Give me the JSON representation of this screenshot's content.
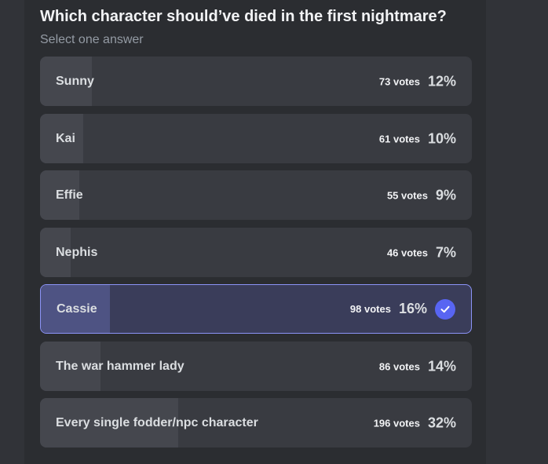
{
  "poll": {
    "question": "Which character should’ve died in the first nightmare?",
    "subtitle": "Select one answer",
    "accent_color": "#5865f2",
    "selected_border_color": "#8c94f8",
    "options": [
      {
        "label": "Sunny",
        "votes": "73 votes",
        "percent": "12%",
        "fraction": 0.12,
        "selected": false
      },
      {
        "label": "Kai",
        "votes": "61 votes",
        "percent": "10%",
        "fraction": 0.1,
        "selected": false
      },
      {
        "label": "Effie",
        "votes": "55 votes",
        "percent": "9%",
        "fraction": 0.09,
        "selected": false
      },
      {
        "label": "Nephis",
        "votes": "46 votes",
        "percent": "7%",
        "fraction": 0.07,
        "selected": false
      },
      {
        "label": "Cassie",
        "votes": "98 votes",
        "percent": "16%",
        "fraction": 0.16,
        "selected": true,
        "icon": "check-icon"
      },
      {
        "label": "The war hammer lady",
        "votes": "86 votes",
        "percent": "14%",
        "fraction": 0.14,
        "selected": false
      },
      {
        "label": "Every single fodder/npc character",
        "votes": "196 votes",
        "percent": "32%",
        "fraction": 0.32,
        "selected": false
      }
    ]
  }
}
